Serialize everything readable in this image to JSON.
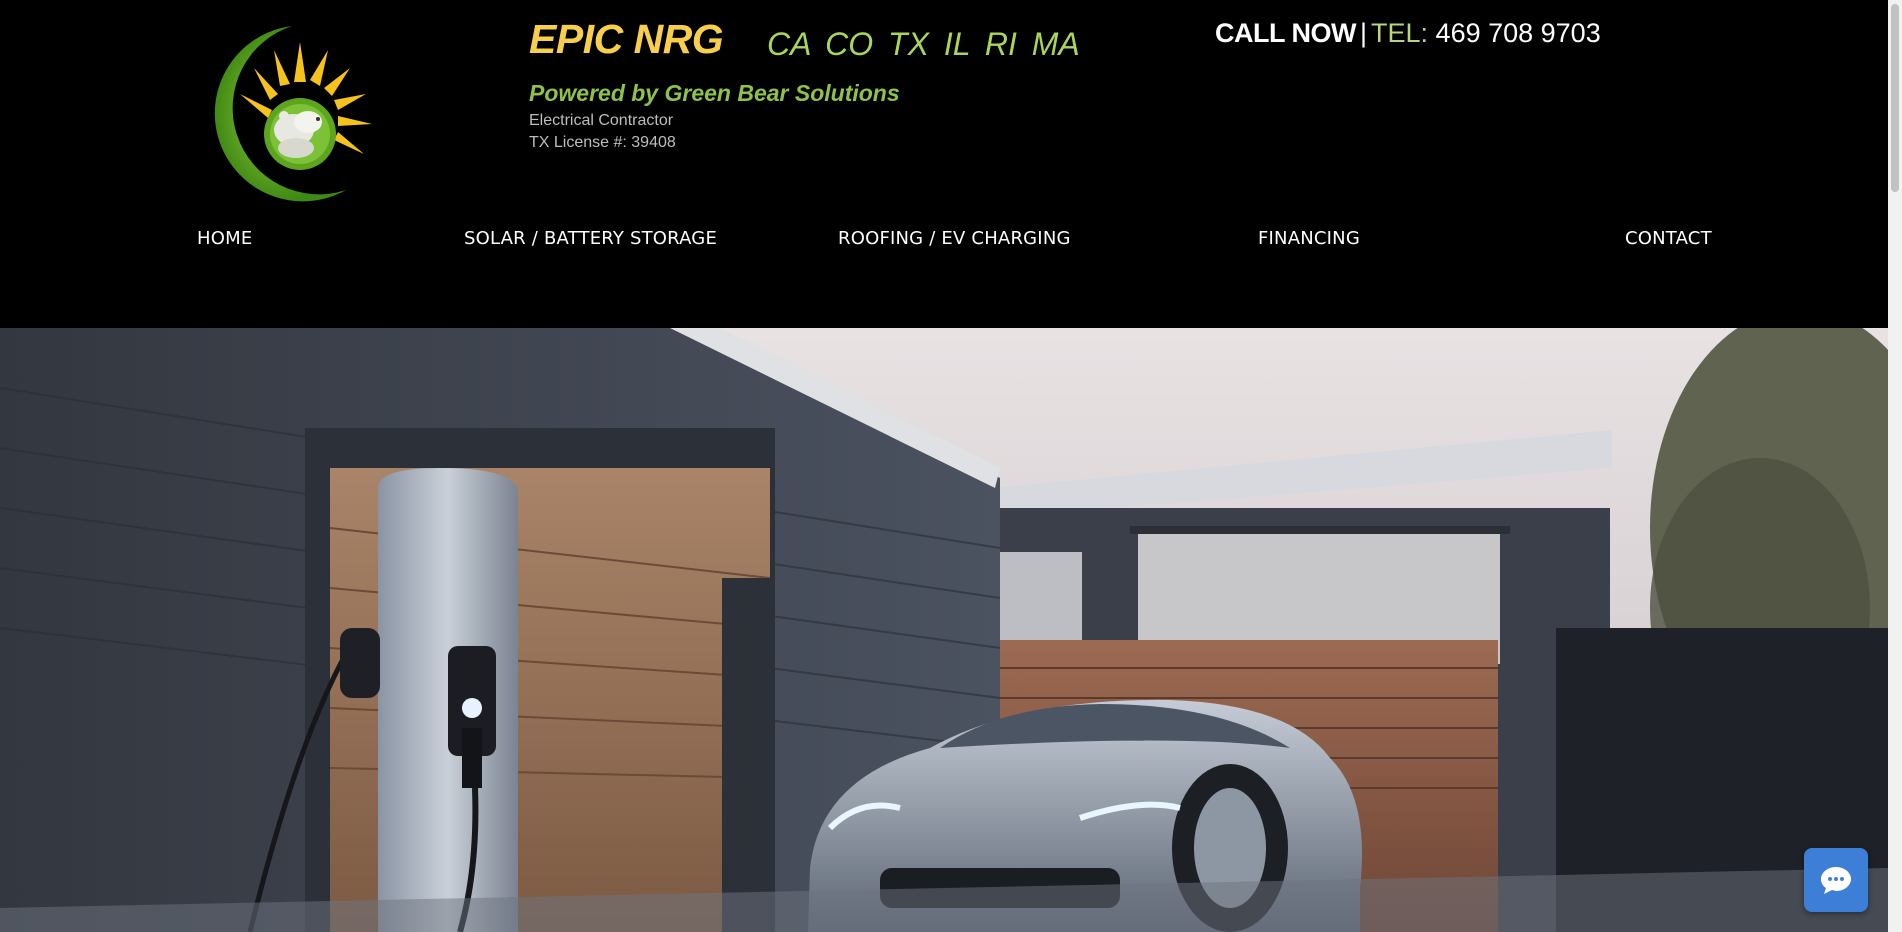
{
  "header": {
    "brand_title": "EPIC NRG",
    "states": "CA CO TX IL RI MA",
    "tagline": "Powered by Green Bear Solutions",
    "subline_1": "Electrical Contractor",
    "subline_2": "TX License #: 39408",
    "call_now": "CALL NOW",
    "separator": "|",
    "tel_label": "TEL:",
    "tel_number": "469 708 9703"
  },
  "nav": {
    "items": [
      {
        "label": "HOME"
      },
      {
        "label": "SOLAR / BATTERY STORAGE"
      },
      {
        "label": "ROOFING / EV CHARGING"
      },
      {
        "label": "FINANCING"
      },
      {
        "label": "CONTACT"
      }
    ]
  },
  "hero": {
    "icon": "hero-image"
  },
  "chat": {
    "icon": "chat-icon",
    "color": "#3d7fd6"
  },
  "colors": {
    "background": "#000000",
    "brand_yellow": "#f7cf4c",
    "brand_green": "#8fc24c",
    "tel_green": "#b8d67a"
  }
}
